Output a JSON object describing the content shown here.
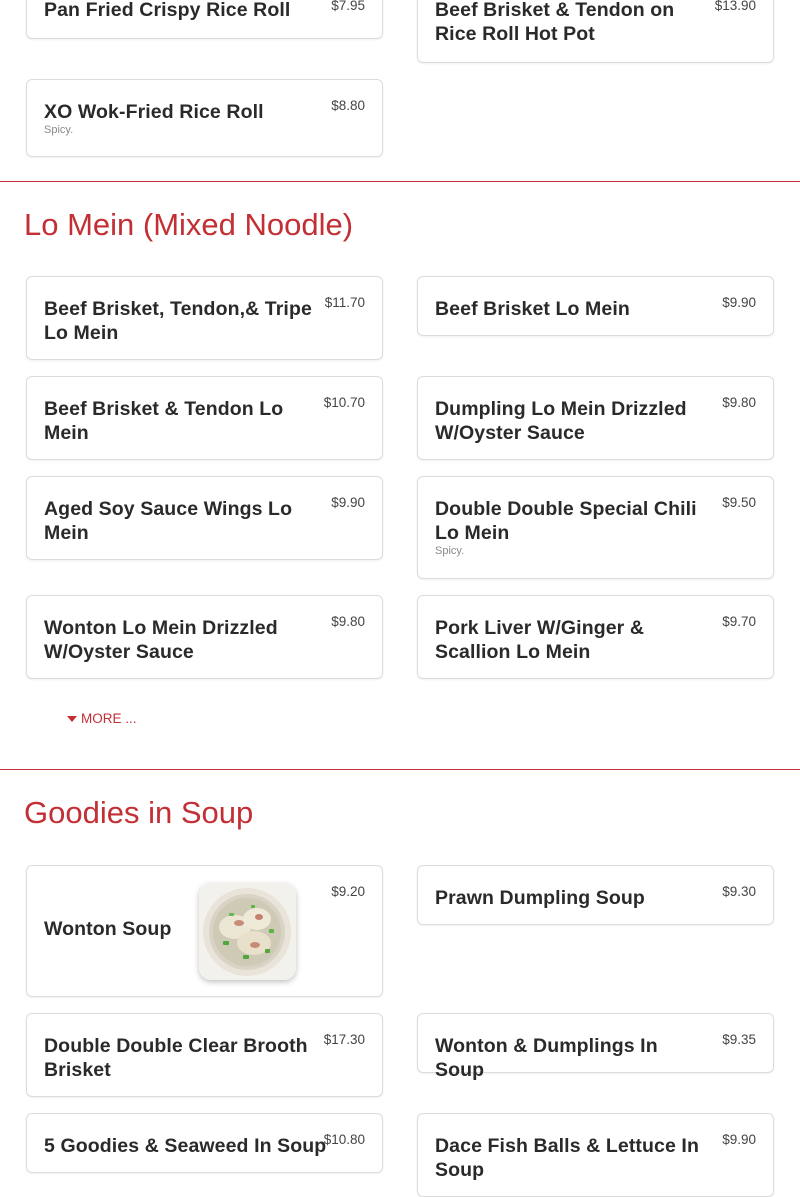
{
  "sections": {
    "rice_roll": {
      "items": [
        {
          "name": "Pan Fried Crispy Rice Roll",
          "price": "$7.95"
        },
        {
          "name": "Beef Brisket & Tendon on Rice Roll Hot Pot",
          "price": "$13.90"
        },
        {
          "name": "XO Wok-Fried Rice Roll",
          "price": "$8.80",
          "desc": "Spicy."
        }
      ]
    },
    "lo_mein": {
      "title": "Lo Mein (Mixed Noodle)",
      "items": [
        {
          "name": "Beef Brisket, Tendon,& Tripe Lo Mein",
          "price": "$11.70"
        },
        {
          "name": "Beef Brisket Lo Mein",
          "price": "$9.90"
        },
        {
          "name": "Beef Brisket & Tendon Lo Mein",
          "price": "$10.70"
        },
        {
          "name": "Dumpling Lo Mein Drizzled W/Oyster Sauce",
          "price": "$9.80"
        },
        {
          "name": "Aged Soy Sauce Wings Lo Mein",
          "price": "$9.90"
        },
        {
          "name": "Double Double Special Chili Lo Mein",
          "price": "$9.50",
          "desc": "Spicy."
        },
        {
          "name": "Wonton Lo Mein Drizzled W/Oyster Sauce",
          "price": "$9.80"
        },
        {
          "name": "Pork Liver W/Ginger & Scallion Lo Mein",
          "price": "$9.70"
        }
      ],
      "more_label": "MORE ..."
    },
    "goodies_soup": {
      "title": "Goodies in Soup",
      "items": [
        {
          "name": "Wonton Soup",
          "price": "$9.20"
        },
        {
          "name": "Prawn Dumpling Soup",
          "price": "$9.30"
        },
        {
          "name": "Double Double Clear Brooth Brisket",
          "price": "$17.30"
        },
        {
          "name": "Wonton & Dumplings In Soup",
          "price": "$9.35"
        },
        {
          "name": "5 Goodies & Seaweed In Soup",
          "price": "$10.80"
        },
        {
          "name": "Dace Fish Balls & Lettuce In Soup",
          "price": "$9.90"
        }
      ]
    }
  },
  "colors": {
    "accent": "#c22f35",
    "divider": "#c8343c",
    "card_border": "#dcdcdc"
  },
  "icons": {
    "more_caret": "caret-down-icon",
    "wonton_photo": "wonton-soup-photo"
  }
}
